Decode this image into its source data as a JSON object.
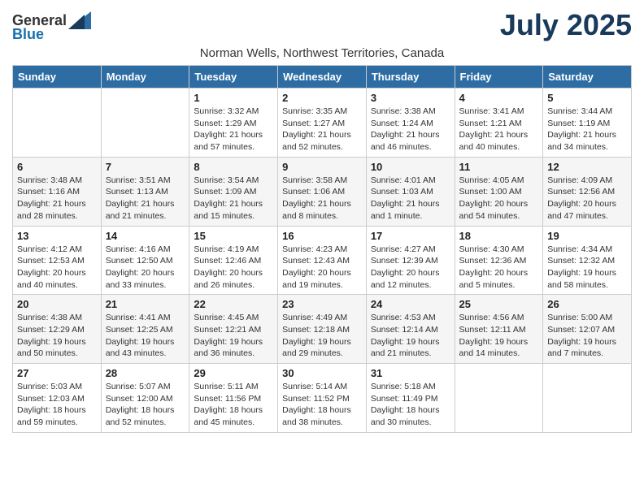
{
  "header": {
    "logo_general": "General",
    "logo_blue": "Blue",
    "month_title": "July 2025",
    "subtitle": "Norman Wells, Northwest Territories, Canada"
  },
  "weekdays": [
    "Sunday",
    "Monday",
    "Tuesday",
    "Wednesday",
    "Thursday",
    "Friday",
    "Saturday"
  ],
  "weeks": [
    [
      {
        "day": "",
        "info": ""
      },
      {
        "day": "",
        "info": ""
      },
      {
        "day": "1",
        "info": "Sunrise: 3:32 AM\nSunset: 1:29 AM\nDaylight: 21 hours and 57 minutes."
      },
      {
        "day": "2",
        "info": "Sunrise: 3:35 AM\nSunset: 1:27 AM\nDaylight: 21 hours and 52 minutes."
      },
      {
        "day": "3",
        "info": "Sunrise: 3:38 AM\nSunset: 1:24 AM\nDaylight: 21 hours and 46 minutes."
      },
      {
        "day": "4",
        "info": "Sunrise: 3:41 AM\nSunset: 1:21 AM\nDaylight: 21 hours and 40 minutes."
      },
      {
        "day": "5",
        "info": "Sunrise: 3:44 AM\nSunset: 1:19 AM\nDaylight: 21 hours and 34 minutes."
      }
    ],
    [
      {
        "day": "6",
        "info": "Sunrise: 3:48 AM\nSunset: 1:16 AM\nDaylight: 21 hours and 28 minutes."
      },
      {
        "day": "7",
        "info": "Sunrise: 3:51 AM\nSunset: 1:13 AM\nDaylight: 21 hours and 21 minutes."
      },
      {
        "day": "8",
        "info": "Sunrise: 3:54 AM\nSunset: 1:09 AM\nDaylight: 21 hours and 15 minutes."
      },
      {
        "day": "9",
        "info": "Sunrise: 3:58 AM\nSunset: 1:06 AM\nDaylight: 21 hours and 8 minutes."
      },
      {
        "day": "10",
        "info": "Sunrise: 4:01 AM\nSunset: 1:03 AM\nDaylight: 21 hours and 1 minute."
      },
      {
        "day": "11",
        "info": "Sunrise: 4:05 AM\nSunset: 1:00 AM\nDaylight: 20 hours and 54 minutes."
      },
      {
        "day": "12",
        "info": "Sunrise: 4:09 AM\nSunset: 12:56 AM\nDaylight: 20 hours and 47 minutes."
      }
    ],
    [
      {
        "day": "13",
        "info": "Sunrise: 4:12 AM\nSunset: 12:53 AM\nDaylight: 20 hours and 40 minutes."
      },
      {
        "day": "14",
        "info": "Sunrise: 4:16 AM\nSunset: 12:50 AM\nDaylight: 20 hours and 33 minutes."
      },
      {
        "day": "15",
        "info": "Sunrise: 4:19 AM\nSunset: 12:46 AM\nDaylight: 20 hours and 26 minutes."
      },
      {
        "day": "16",
        "info": "Sunrise: 4:23 AM\nSunset: 12:43 AM\nDaylight: 20 hours and 19 minutes."
      },
      {
        "day": "17",
        "info": "Sunrise: 4:27 AM\nSunset: 12:39 AM\nDaylight: 20 hours and 12 minutes."
      },
      {
        "day": "18",
        "info": "Sunrise: 4:30 AM\nSunset: 12:36 AM\nDaylight: 20 hours and 5 minutes."
      },
      {
        "day": "19",
        "info": "Sunrise: 4:34 AM\nSunset: 12:32 AM\nDaylight: 19 hours and 58 minutes."
      }
    ],
    [
      {
        "day": "20",
        "info": "Sunrise: 4:38 AM\nSunset: 12:29 AM\nDaylight: 19 hours and 50 minutes."
      },
      {
        "day": "21",
        "info": "Sunrise: 4:41 AM\nSunset: 12:25 AM\nDaylight: 19 hours and 43 minutes."
      },
      {
        "day": "22",
        "info": "Sunrise: 4:45 AM\nSunset: 12:21 AM\nDaylight: 19 hours and 36 minutes."
      },
      {
        "day": "23",
        "info": "Sunrise: 4:49 AM\nSunset: 12:18 AM\nDaylight: 19 hours and 29 minutes."
      },
      {
        "day": "24",
        "info": "Sunrise: 4:53 AM\nSunset: 12:14 AM\nDaylight: 19 hours and 21 minutes."
      },
      {
        "day": "25",
        "info": "Sunrise: 4:56 AM\nSunset: 12:11 AM\nDaylight: 19 hours and 14 minutes."
      },
      {
        "day": "26",
        "info": "Sunrise: 5:00 AM\nSunset: 12:07 AM\nDaylight: 19 hours and 7 minutes."
      }
    ],
    [
      {
        "day": "27",
        "info": "Sunrise: 5:03 AM\nSunset: 12:03 AM\nDaylight: 18 hours and 59 minutes."
      },
      {
        "day": "28",
        "info": "Sunrise: 5:07 AM\nSunset: 12:00 AM\nDaylight: 18 hours and 52 minutes."
      },
      {
        "day": "29",
        "info": "Sunrise: 5:11 AM\nSunset: 11:56 PM\nDaylight: 18 hours and 45 minutes."
      },
      {
        "day": "30",
        "info": "Sunrise: 5:14 AM\nSunset: 11:52 PM\nDaylight: 18 hours and 38 minutes."
      },
      {
        "day": "31",
        "info": "Sunrise: 5:18 AM\nSunset: 11:49 PM\nDaylight: 18 hours and 30 minutes."
      },
      {
        "day": "",
        "info": ""
      },
      {
        "day": "",
        "info": ""
      }
    ]
  ]
}
